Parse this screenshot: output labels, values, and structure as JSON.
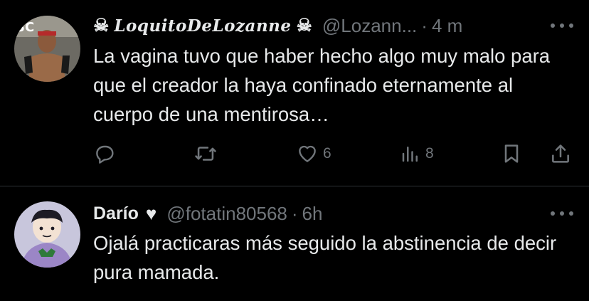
{
  "tweets": [
    {
      "name": "☠ LoquitoDeLozanne ☠",
      "name_decoration_left": "☠",
      "name_decoration_right": "☠",
      "name_main": "LoquitoDeLozanne",
      "handle": "@Lozann...",
      "separator": "·",
      "time": "4 m",
      "text": "La vagina tuvo que haber hecho algo muy malo para que el creador la haya confinado eternamente al cuerpo de una mentirosa…",
      "actions": {
        "reply_count": "",
        "retweet_count": "",
        "like_count": "6",
        "views_count": "8"
      }
    },
    {
      "name": "Darío",
      "heart": "♥",
      "handle": "@fotatin80568",
      "separator": "·",
      "time": "6h",
      "text": "Ojalá practicaras más seguido la abstinencia de decir pura mamada."
    }
  ],
  "colors": {
    "background": "#000000",
    "text": "#e7e9ea",
    "secondary": "#71767b",
    "divider": "#2f3336"
  }
}
